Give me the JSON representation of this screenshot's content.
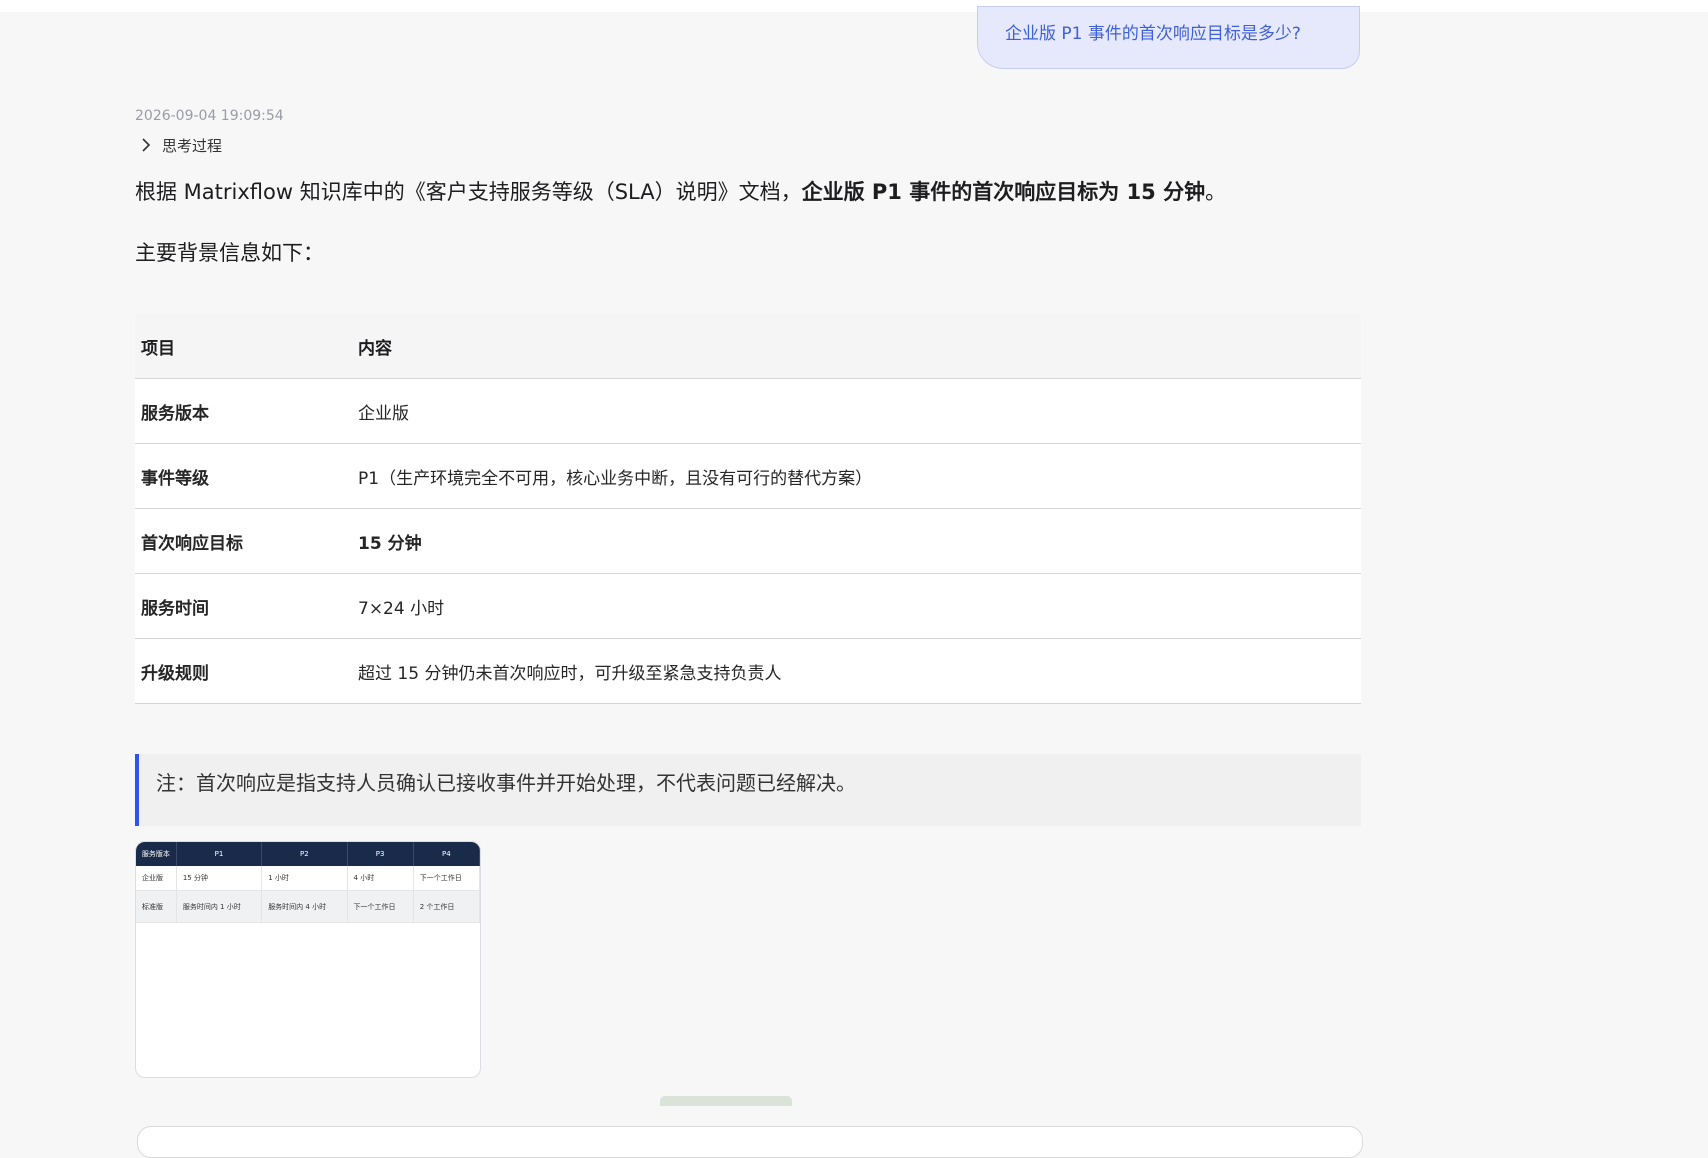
{
  "user_message": "企业版 P1 事件的首次响应目标是多少?",
  "timestamp": "2026-09-04 19:09:54",
  "thinking": {
    "label": "思考过程",
    "icon": "chevron-right-icon"
  },
  "answer": {
    "intro_prefix": "根据 Matrixflow 知识库中的《客户支持服务等级（SLA）说明》文档，",
    "intro_bold": "企业版 P1 事件的首次响应目标为 15 分钟",
    "intro_suffix": "。",
    "subhead": "主要背景信息如下："
  },
  "table": {
    "headers": [
      "项目",
      "内容"
    ],
    "rows": [
      {
        "key": "服务版本",
        "value": "企业版"
      },
      {
        "key": "事件等级",
        "value": "P1（生产环境完全不可用，核心业务中断，且没有可行的替代方案）"
      },
      {
        "key": "首次响应目标",
        "value": "15 分钟"
      },
      {
        "key": "服务时间",
        "value": "7×24 小时"
      },
      {
        "key": "升级规则",
        "value": "超过 15 分钟仍未首次响应时，可升级至紧急支持负责人"
      }
    ]
  },
  "note": "注：首次响应是指支持人员确认已接收事件并开始处理，不代表问题已经解决。",
  "thumbnail": {
    "headers": [
      "服务版本",
      "P1",
      "P2",
      "P3",
      "P4"
    ],
    "rows": [
      [
        "企业版",
        "15 分钟",
        "1 小时",
        "4 小时",
        "下一个工作日"
      ],
      [
        "标准版",
        "服务时间内 1 小时",
        "服务时间内 4 小时",
        "下一个工作日",
        "2 个工作日"
      ]
    ]
  },
  "colors": {
    "accent": "#2f54eb",
    "user_bubble_bg": "#e6e9fb",
    "user_text": "#3f5fd6",
    "thumb_header": "#1a2a4a"
  }
}
